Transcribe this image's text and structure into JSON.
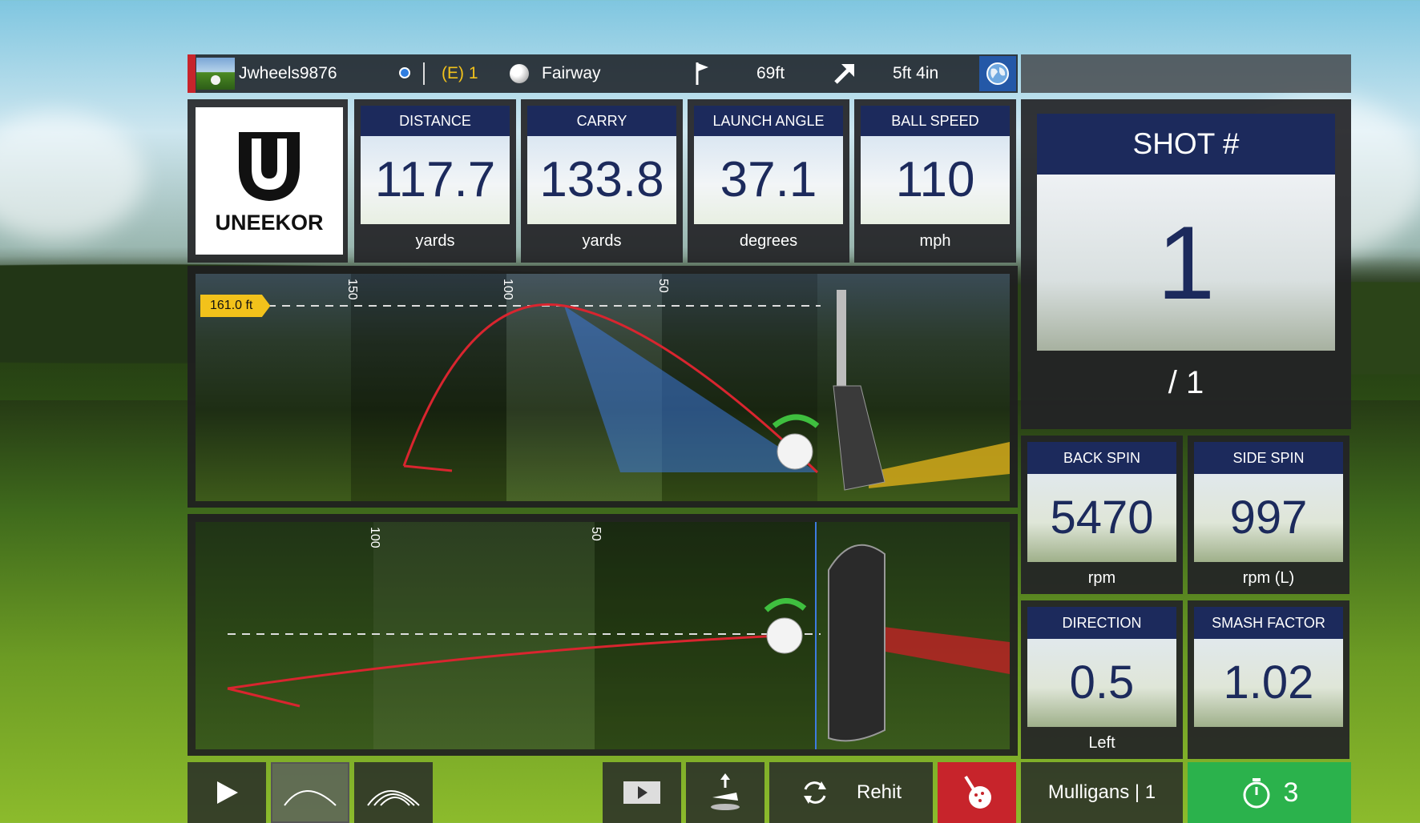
{
  "topbar": {
    "player": "Jwheels9876",
    "score": "(E) 1",
    "lie": "Fairway",
    "pin_distance": "69ft",
    "putt_distance": "5ft 4in"
  },
  "logo": {
    "text": "UNEEKOR"
  },
  "stats": [
    {
      "label": "DISTANCE",
      "value": "117.7",
      "unit": "yards"
    },
    {
      "label": "CARRY",
      "value": "133.8",
      "unit": "yards"
    },
    {
      "label": "LAUNCH ANGLE",
      "value": "37.1",
      "unit": "degrees"
    },
    {
      "label": "BALL SPEED",
      "value": "110",
      "unit": "mph"
    }
  ],
  "shot": {
    "label": "SHOT #",
    "number": "1",
    "total": "/ 1"
  },
  "spin": [
    {
      "label": "BACK SPIN",
      "value": "5470",
      "unit": "rpm"
    },
    {
      "label": "SIDE SPIN",
      "value": "997",
      "unit": "rpm (L)"
    },
    {
      "label": "DIRECTION",
      "value": "0.5",
      "unit": "Left"
    },
    {
      "label": "SMASH FACTOR",
      "value": "1.02",
      "unit": ""
    }
  ],
  "side_view": {
    "apex_label": "161.0 ft",
    "ticks": [
      "150",
      "100",
      "50"
    ]
  },
  "top_view": {
    "ticks": [
      "100",
      "50"
    ]
  },
  "toolbar": {
    "rehit_label": "Rehit",
    "mulligans_label": "Mulligans | 1",
    "timer_value": "3"
  },
  "colors": {
    "header_navy": "#1c2a5c",
    "accent_red": "#c7242b",
    "timer_green": "#2bb24c",
    "trajectory_red": "#d9252f",
    "apex_yellow": "#f2c21b"
  }
}
